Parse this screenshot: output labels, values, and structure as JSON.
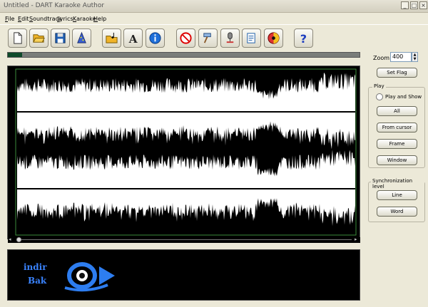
{
  "window": {
    "title": "Untitled - DART Karaoke Author"
  },
  "menu": [
    "File",
    "Edit",
    "Soundtrack",
    "Lyrics",
    "Karaoke",
    "Help"
  ],
  "toolbar": [
    {
      "name": "new-button",
      "icon": "new-document-icon"
    },
    {
      "name": "open-button",
      "icon": "folder-open-icon"
    },
    {
      "name": "save-button",
      "icon": "floppy-disk-icon"
    },
    {
      "name": "wizard-button",
      "icon": "wizard-hat-icon"
    },
    {
      "name": "open-soundtrack-button",
      "icon": "folder-music-icon"
    },
    {
      "name": "font-button",
      "icon": "font-icon"
    },
    {
      "name": "info-button",
      "icon": "info-icon"
    },
    {
      "name": "no-tool-button",
      "icon": "no-sign-icon"
    },
    {
      "name": "hammer-button",
      "icon": "hammer-icon"
    },
    {
      "name": "microphone-button",
      "icon": "microphone-icon"
    },
    {
      "name": "lyrics-sheet-button",
      "icon": "lyrics-sheet-icon"
    },
    {
      "name": "disc-button",
      "icon": "disc-icon"
    },
    {
      "name": "help-button",
      "icon": "help-question-icon"
    }
  ],
  "zoom": {
    "label": "Zoom:",
    "value": "400"
  },
  "set_flag_label": "Set Flag",
  "play": {
    "group_label": "Play",
    "play_and_show_label": "Play and Show",
    "buttons": [
      "All",
      "From cursor",
      "Frame",
      "Window"
    ]
  },
  "sync": {
    "group_label": "Synchronization level",
    "buttons": [
      "Line",
      "Word"
    ]
  },
  "progress_fraction": 0.04,
  "logo": {
    "line1": "indir",
    "line2": "Bak"
  },
  "colors": {
    "waveform": "#ffffff",
    "background": "#000000",
    "progress": "#0f4a2a",
    "logo": "#3a83ff"
  }
}
